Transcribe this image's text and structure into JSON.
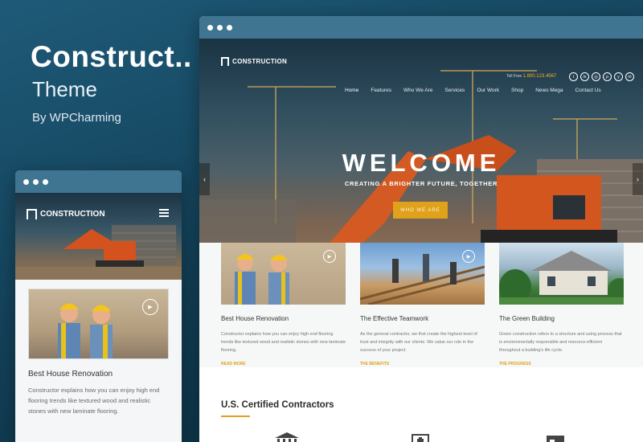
{
  "promo": {
    "title": "Construct..",
    "subtitle": "Theme",
    "byline": "By WPCharming"
  },
  "brand": {
    "logo_mark": "C",
    "name": "CONSTRUCTION",
    "accent_color": "#e0a11b",
    "window_bar_color": "#3f7590"
  },
  "desktop": {
    "phone_label": "Toll Free",
    "phone_number": "1.800.123.4567",
    "social_icons": [
      "twitter-icon",
      "linkedin-icon",
      "instagram-icon",
      "pinterest-icon",
      "yelp-icon",
      "email-icon"
    ],
    "social_glyphs": [
      "t",
      "in",
      "◎",
      "p",
      "y",
      "✉"
    ],
    "nav": [
      "Home",
      "Features",
      "Who We Are",
      "Services",
      "Our Work",
      "Shop",
      "News Mega",
      "Contact Us"
    ],
    "hero_title": "WELCOME",
    "hero_tagline": "CREATING A BRIGHTER FUTURE, TOGETHER",
    "hero_button": "WHO WE ARE",
    "arrow_left": "‹",
    "arrow_right": "›",
    "cards": [
      {
        "title": "Best House Renovation",
        "text": "Constructor explains how you can enjoy high end flooring trends like textured wood and realistic stones with new laminate flooring.",
        "link": "READ MORE",
        "has_play": true
      },
      {
        "title": "The Effective Teamwork",
        "text": "As the general contractor, we first create the highest level of trust and integrity with our clients. We value our role in the success of your project.",
        "link": "THE BENEFITS",
        "has_play": true
      },
      {
        "title": "The Green Building",
        "text": "Green construction refers to a structure and using process that is environmentally responsible and resource-efficient throughout a building's life cycle.",
        "link": "THE PROGRESS",
        "has_play": false
      }
    ],
    "certified_title": "U.S. Certified Contractors"
  },
  "mobile": {
    "card_title": "Best House Renovation",
    "card_text": "Constructor explains how you can enjoy high end flooring trends like textured wood and realistic stones with new laminate flooring."
  },
  "icons": {
    "play_glyph": "▶"
  }
}
